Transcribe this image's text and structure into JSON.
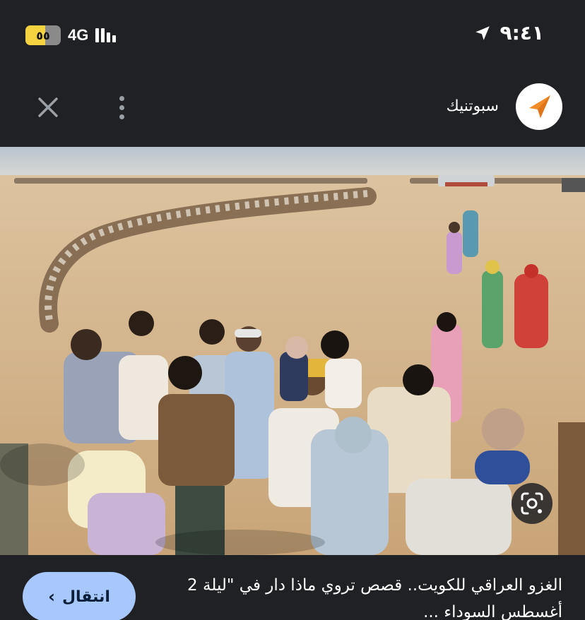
{
  "status_bar": {
    "battery_glyph": "٥٥",
    "battery_level": 0.55,
    "network": "4G",
    "time": "٩:٤١"
  },
  "header": {
    "publisher_name": "سبوتنيك",
    "close_icon": "close-icon",
    "more_icon": "more-vert-icon",
    "logo_icon": "sputnik-logo"
  },
  "photo": {
    "lens_icon": "google-lens-icon"
  },
  "bottom": {
    "visit_label": "انتقال",
    "caption": "الغزو العراقي للكويت.. قصص تروي ماذا دار في \"ليلة 2 أغسطس السوداء ..."
  },
  "colors": {
    "background": "#202124",
    "button": "#a8c7fa",
    "logo_accent": "#f08b2a",
    "battery": "#f5d23f"
  }
}
